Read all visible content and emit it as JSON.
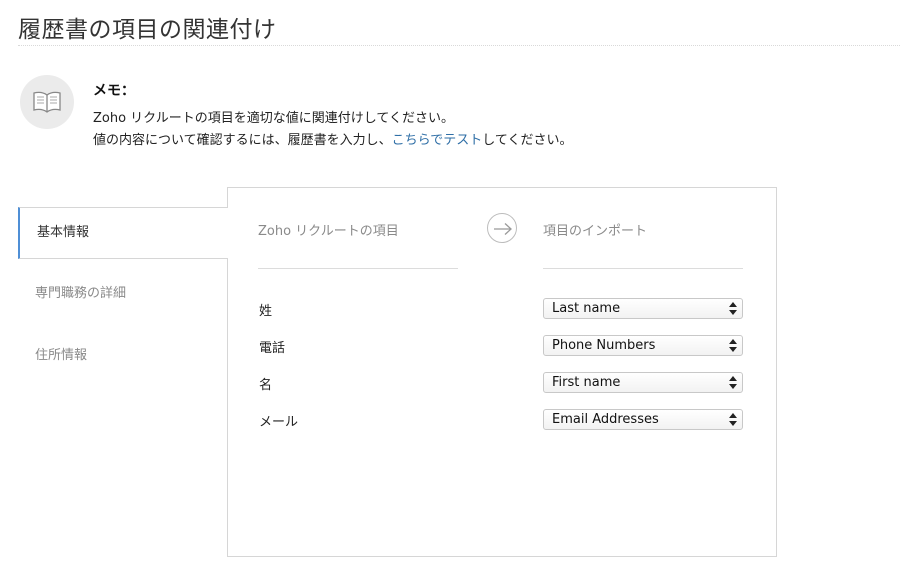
{
  "page": {
    "title": "履歴書の項目の関連付け"
  },
  "memo": {
    "icon": "open-book-icon",
    "title": "メモ：",
    "line1": "Zoho リクルートの項目を適切な値に関連付けしてください。",
    "line2_before": "値の内容について確認するには、履歴書を入力し、",
    "line2_link": "こちらでテスト",
    "line2_after": "してください。"
  },
  "tabs": [
    {
      "label": "基本情報",
      "active": true
    },
    {
      "label": "専門職務の詳細",
      "active": false
    },
    {
      "label": "住所情報",
      "active": false
    }
  ],
  "mapping": {
    "left_header": "Zoho リクルートの項目",
    "right_header": "項目のインポート",
    "arrow_icon": "right-arrow-icon",
    "rows": [
      {
        "field": "姓",
        "import_value": "Last name"
      },
      {
        "field": "電話",
        "import_value": "Phone Numbers"
      },
      {
        "field": "名",
        "import_value": "First name"
      },
      {
        "field": "メール",
        "import_value": "Email Addresses"
      }
    ]
  },
  "colors": {
    "link": "#2e6ea6",
    "active_tab_accent": "#4f8fd6"
  }
}
